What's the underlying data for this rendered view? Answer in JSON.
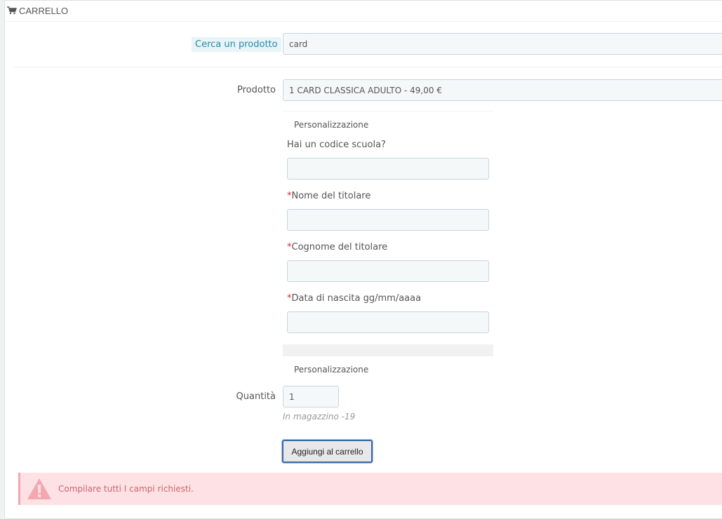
{
  "panel": {
    "title": "CARRELLO",
    "icon": "cart-icon"
  },
  "search": {
    "label": "Cerca un prodotto",
    "value": "card"
  },
  "product": {
    "label": "Prodotto",
    "selected": "1 CARD CLASSICA ADULTO - 49,00 €"
  },
  "customization": {
    "title": "Personalizzazione",
    "second_title": "Personalizzazione",
    "fields": [
      {
        "label": "Hai un codice scuola?",
        "required": false,
        "value": ""
      },
      {
        "label": "Nome del titolare",
        "required": true,
        "value": ""
      },
      {
        "label": "Cognome del titolare",
        "required": true,
        "value": ""
      },
      {
        "label": "Data di nascita gg/mm/aaaa",
        "required": true,
        "value": ""
      }
    ],
    "required_mark": "*"
  },
  "quantity": {
    "label": "Quantità",
    "value": "1",
    "stock_note": "In magazzino -19"
  },
  "add_button": {
    "label": "Aggiungi al carrello"
  },
  "alert": {
    "message": "Compilare tutti I campi richiesti.",
    "icon": "warning-icon"
  },
  "colors": {
    "accent": "#2a8aa8",
    "required": "#d9272e",
    "alert_bg": "#fde1e4",
    "alert_text": "#d0656f",
    "button_border": "#3b6ba9"
  }
}
